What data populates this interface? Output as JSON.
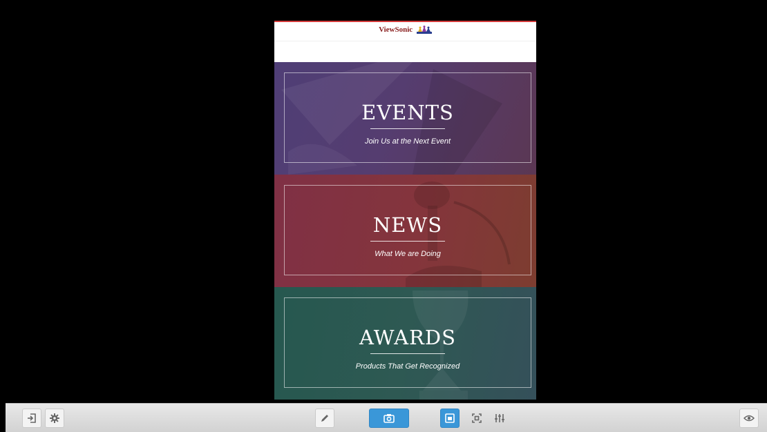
{
  "header": {
    "brand": "ViewSonic"
  },
  "panels": [
    {
      "title": "EVENTS",
      "subtitle": "Join Us at the Next Event"
    },
    {
      "title": "NEWS",
      "subtitle": "What We are Doing"
    },
    {
      "title": "AWARDS",
      "subtitle": "Products That Get Recognized"
    }
  ],
  "toolbar": {
    "left_icons": [
      "exit-icon",
      "gear-icon"
    ],
    "center_icons": [
      "pencil-icon",
      "camera-icon",
      "fit-screen-icon",
      "crop-icon",
      "adjust-sliders-icon"
    ],
    "right_icons": [
      "eye-icon"
    ]
  },
  "colors": {
    "events_bg": "#553d70",
    "news_bg": "#84353c",
    "awards_bg": "#2e5953",
    "toolbar_accent": "#3a97d8",
    "brand_red": "#8a2020"
  }
}
